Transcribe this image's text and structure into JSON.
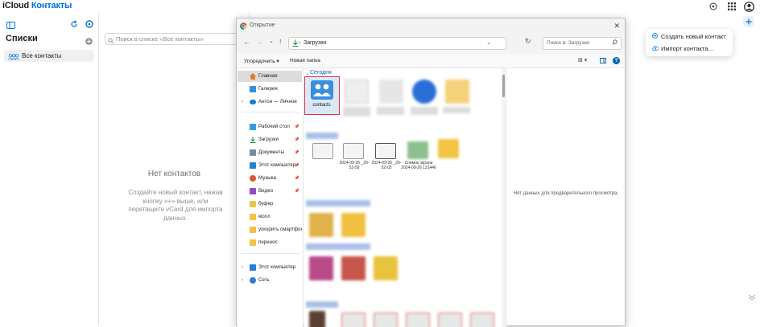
{
  "app": {
    "brand_icloud": "iCloud",
    "brand_contacts": "Контакты"
  },
  "sidebar": {
    "title": "Списки",
    "items": [
      {
        "label": "Все контакты"
      }
    ]
  },
  "list": {
    "search_placeholder": "Поиск в списке «Все контакты»",
    "empty_title": "Нет контактов",
    "empty_desc": "Создайте новый контакт, нажав кнопку «+» выше, или перетащите vCard для импорта данных."
  },
  "popup": {
    "items": [
      {
        "label": "Создать новый контакт",
        "icon": "plus-circle-icon"
      },
      {
        "label": "Импорт контакта…",
        "icon": "cloud-upload-icon"
      }
    ]
  },
  "dialog": {
    "title": "Открытие",
    "address": "Загрузки",
    "search_placeholder": "Поиск в: Загрузки",
    "organize_label": "Упорядочить",
    "new_folder_label": "Новая папка",
    "preview_text": "Нет данных для предварительного просмотра.",
    "nav_items": [
      {
        "label": "Главная"
      },
      {
        "label": "Галерея"
      },
      {
        "label": "Антон — Личное"
      },
      {
        "label": "Рабочий стол"
      },
      {
        "label": "Загрузки"
      },
      {
        "label": "Документы"
      },
      {
        "label": "Этот компьютер"
      },
      {
        "label": "Музыка"
      },
      {
        "label": "Видео"
      },
      {
        "label": "буфер"
      },
      {
        "label": "молл"
      },
      {
        "label": "ускорить смартфон"
      },
      {
        "label": "перенос"
      },
      {
        "label": "Этот компьютер"
      },
      {
        "label": "Сеть"
      }
    ],
    "group_today": "Сегодня",
    "selected_file": "contacts",
    "files_row2": [
      "2024-09-26 _20-52-59",
      "2024-09-26 _20-52-03",
      "Снимок экрана 2024-09-26 131446"
    ]
  },
  "colors": {
    "accent": "#0071e3",
    "selection_border": "#d9333f"
  }
}
